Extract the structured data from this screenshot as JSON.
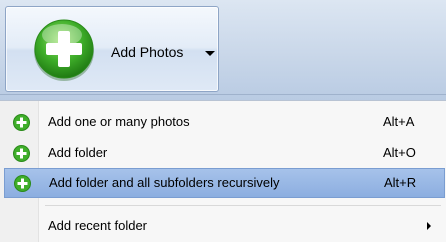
{
  "toolbar": {
    "add_photos_label": "Add Photos",
    "add_photos_icon": "green-plus-icon",
    "dropdown_icon": "chevron-down-icon"
  },
  "menu": {
    "items": [
      {
        "label": "Add one or many photos",
        "shortcut": "Alt+A",
        "icon": "green-plus-icon",
        "highlighted": false
      },
      {
        "label": "Add folder",
        "shortcut": "Alt+O",
        "icon": "green-plus-icon",
        "highlighted": false
      },
      {
        "label": "Add folder and all subfolders recursively",
        "shortcut": "Alt+R",
        "icon": "green-plus-icon",
        "highlighted": true
      },
      {
        "label": "Add recent folder",
        "shortcut": "",
        "icon": "submenu-arrow-icon",
        "highlighted": false
      }
    ]
  },
  "colors": {
    "accent_green": "#3fae2a",
    "highlight": "#9bbbe6",
    "toolbar_bg": "#c9d7e9"
  }
}
